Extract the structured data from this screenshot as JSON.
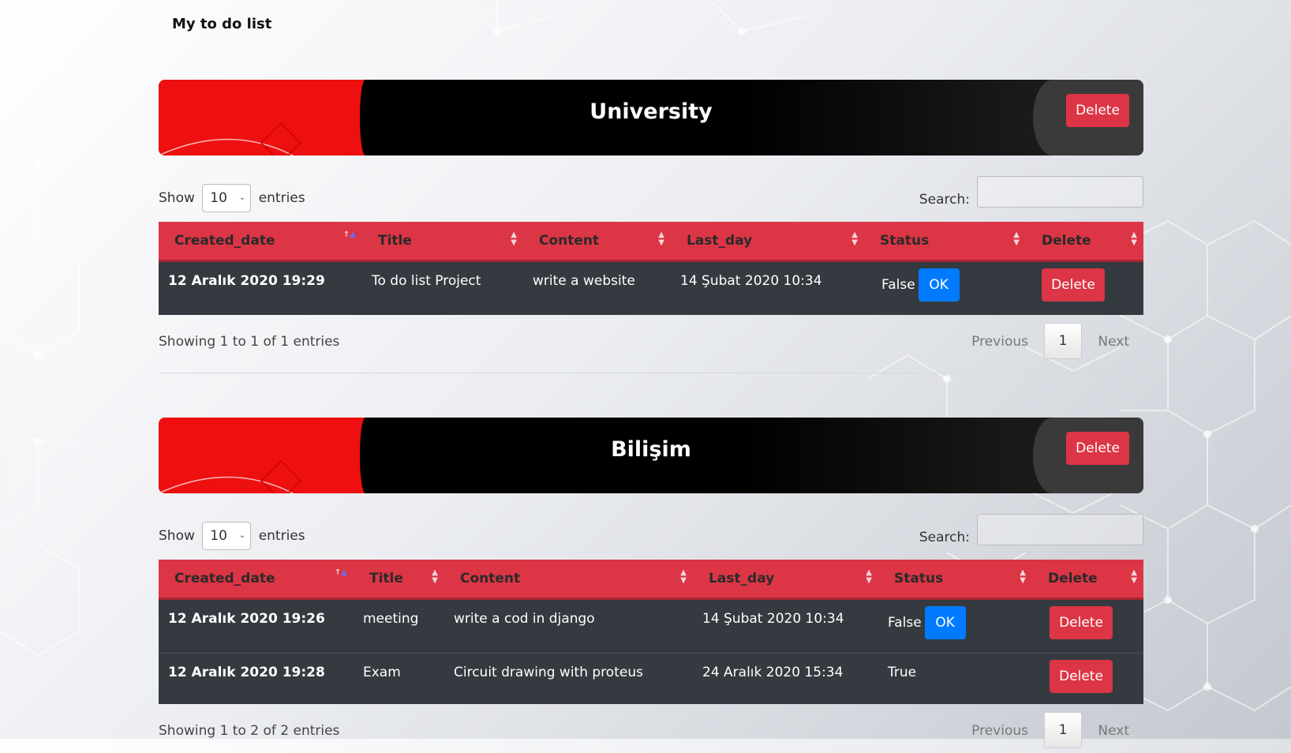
{
  "brand": "My to do list",
  "lists": [
    {
      "title": "University",
      "delete_label": "Delete",
      "show_label": "Show",
      "entries_label": "entries",
      "page_size": "10",
      "search_label": "Search:",
      "columns": [
        "Created_date",
        "Title",
        "Content",
        "Last_day",
        "Status",
        "Delete"
      ],
      "rows": [
        {
          "created": "12 Aralık 2020 19:29",
          "title": "To do list Project",
          "content": "write a website",
          "last_day": "14 Şubat 2020 10:34",
          "status": "False",
          "ok_label": "OK",
          "delete_label": "Delete"
        }
      ],
      "info": "Showing 1 to 1 of 1 entries",
      "prev_label": "Previous",
      "page": "1",
      "next_label": "Next"
    },
    {
      "title": "Bilişim",
      "delete_label": "Delete",
      "show_label": "Show",
      "entries_label": "entries",
      "page_size": "10",
      "search_label": "Search:",
      "columns": [
        "Created_date",
        "Title",
        "Content",
        "Last_day",
        "Status",
        "Delete"
      ],
      "rows": [
        {
          "created": "12 Aralık 2020 19:26",
          "title": "meeting",
          "content": "write a cod in django",
          "last_day": "14 Şubat 2020 10:34",
          "status": "False",
          "ok_label": "OK",
          "delete_label": "Delete"
        },
        {
          "created": "12 Aralık 2020 19:28",
          "title": "Exam",
          "content": "Circuit drawing with proteus",
          "last_day": "24 Aralık 2020 15:34",
          "status": "True",
          "delete_label": "Delete"
        }
      ],
      "info": "Showing 1 to 2 of 2 entries",
      "prev_label": "Previous",
      "page": "1",
      "next_label": "Next"
    }
  ],
  "colors": {
    "accent_red": "#dc3545",
    "ok_blue": "#007bff",
    "row_dark": "#343a40",
    "banner_red": "#ee1010"
  }
}
